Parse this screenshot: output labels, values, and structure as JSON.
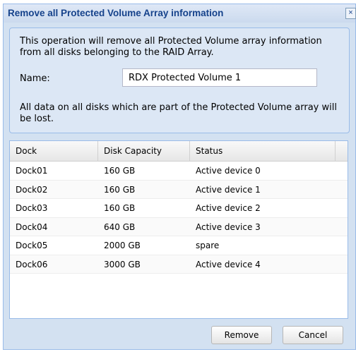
{
  "dialog": {
    "title": "Remove all Protected Volume Array information",
    "close_glyph": "×"
  },
  "info": {
    "message": "This operation will remove all Protected Volume array information from all disks belonging to the RAID Array.",
    "name_label": "Name:",
    "name_value": "RDX Protected Volume 1",
    "warning": "All data on all disks which are part of the Protected Volume array will be lost."
  },
  "grid": {
    "columns": [
      "Dock",
      "Disk Capacity",
      "Status"
    ],
    "rows": [
      {
        "dock": "Dock01",
        "capacity": "160 GB",
        "status": "Active device 0"
      },
      {
        "dock": "Dock02",
        "capacity": "160 GB",
        "status": "Active device 1"
      },
      {
        "dock": "Dock03",
        "capacity": "160 GB",
        "status": "Active device 2"
      },
      {
        "dock": "Dock04",
        "capacity": "640 GB",
        "status": "Active device 3"
      },
      {
        "dock": "Dock05",
        "capacity": "2000 GB",
        "status": "spare"
      },
      {
        "dock": "Dock06",
        "capacity": "3000 GB",
        "status": "Active device 4"
      }
    ]
  },
  "buttons": {
    "remove": "Remove",
    "cancel": "Cancel"
  }
}
